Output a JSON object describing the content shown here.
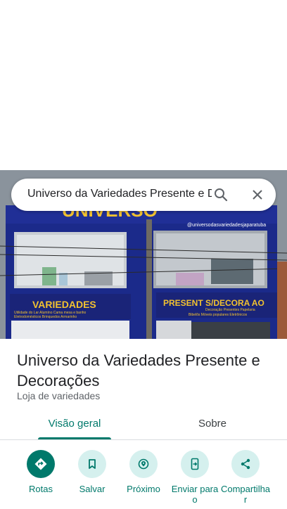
{
  "search": {
    "value": "Universo da Variedades Presente e D"
  },
  "photo": {
    "sign_top": "UNIVERSO",
    "sign_handle": "@universodasvariedadesjaparatuba",
    "left_sign": "VARIEDADES",
    "left_sign_items": "Utilidade do Lar  Alumíno  Cama mesa e banho",
    "left_sign_items2": "Eletrodomésticos  Brinquedos  Armarinho",
    "right_sign": "PRESENT S/DECORA AO",
    "right_sign_items": "Decoração  Presentes  Papelaria",
    "right_sign_items2": "Bibelôs  Móveis populares  Eletrônicos"
  },
  "place": {
    "title": "Universo da Variedades Presente e Decorações",
    "category": "Loja de variedades"
  },
  "tabs": [
    {
      "label": "Visão geral",
      "active": true
    },
    {
      "label": "Sobre",
      "active": false
    }
  ],
  "actions": [
    {
      "label": "Rotas",
      "icon": "directions-icon"
    },
    {
      "label": "Salvar",
      "icon": "bookmark-icon"
    },
    {
      "label": "Próximo",
      "icon": "nearby-icon"
    },
    {
      "label": "Enviar para o",
      "icon": "send-to-phone-icon"
    },
    {
      "label": "Compartilhar",
      "icon": "share-icon"
    }
  ],
  "colors": {
    "accent": "#00796b",
    "accent_light": "#d5f0ee",
    "facade": "#1b2a8a",
    "sign_text": "#f2c230"
  }
}
